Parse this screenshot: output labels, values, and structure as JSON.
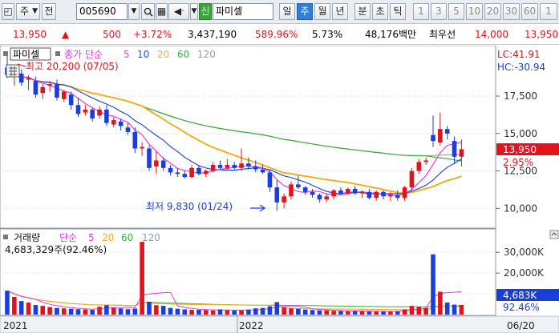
{
  "toolbar": {
    "period_type": "주",
    "prev_label": "전",
    "code": "005690",
    "sin_label": "신",
    "name": "파미셀",
    "periods": [
      "일",
      "주",
      "월",
      "년",
      "분",
      "초",
      "틱"
    ],
    "selected_period": "주",
    "numbers": [
      "1",
      "3",
      "5",
      "10",
      "20",
      "30",
      "60",
      "1"
    ]
  },
  "quote": {
    "price": "13,950",
    "change": "500",
    "change_pct": "+3.72%",
    "volume": "3,437,190",
    "vol_ratio": "589.96%",
    "turnover": "5.73%",
    "amount": "48,176백만",
    "best_ask_label": "최우선",
    "best_ask": "14,000",
    "best_bid": "13,950"
  },
  "colors": {
    "up": "#e0141e",
    "down": "#1a3fd8",
    "ma5": "#e83ae0",
    "ma10": "#2a4fd8",
    "ma20": "#f0b020",
    "ma60": "#3cae3c",
    "ma120": "#a0a0a0"
  },
  "price_panel": {
    "title": "파미셀",
    "legend_prefix": "종가 단순",
    "legend_items": [
      "5",
      "10",
      "20",
      "60",
      "120"
    ],
    "lc": "LC:41.91",
    "hc": "HC:-30.94",
    "high_label": "최고 20,200 (07/05)",
    "low_label": "최저 9,830 (01/24)",
    "axis": [
      "17,500",
      "15,000",
      "12,500",
      "10,000"
    ],
    "current_tag": "13,950",
    "pct_tag": "2.95%"
  },
  "volume_panel": {
    "title": "거래량",
    "legend_prefix": "단순",
    "legend_items": [
      "5",
      "20",
      "60",
      "120"
    ],
    "value_label": "4,683,329주(92.46%)",
    "axis": [
      "30,000K",
      "20,000K",
      "10,000K"
    ],
    "current_tag": "4,683K",
    "pct_tag": "92.46%"
  },
  "x_axis": {
    "labels": [
      "2021",
      "2022"
    ],
    "right_label": "06/20"
  },
  "chart_data": {
    "type": "candlestick",
    "price_ylim": [
      9000,
      19800
    ],
    "volume_ylim": [
      0,
      37000000
    ],
    "candles": [
      {
        "o": 19400,
        "h": 20200,
        "l": 18700,
        "c": 18900
      },
      {
        "o": 18800,
        "h": 19300,
        "l": 18200,
        "c": 19000
      },
      {
        "o": 19000,
        "h": 19300,
        "l": 18200,
        "c": 18400
      },
      {
        "o": 18600,
        "h": 18900,
        "l": 17900,
        "c": 18700
      },
      {
        "o": 18500,
        "h": 18800,
        "l": 17400,
        "c": 17600
      },
      {
        "o": 17700,
        "h": 18300,
        "l": 17300,
        "c": 18100
      },
      {
        "o": 18200,
        "h": 18500,
        "l": 17800,
        "c": 18300
      },
      {
        "o": 18300,
        "h": 18600,
        "l": 17200,
        "c": 17400
      },
      {
        "o": 17300,
        "h": 17900,
        "l": 17100,
        "c": 17800
      },
      {
        "o": 17600,
        "h": 17800,
        "l": 16600,
        "c": 16900
      },
      {
        "o": 16900,
        "h": 17400,
        "l": 16100,
        "c": 16300
      },
      {
        "o": 16400,
        "h": 16900,
        "l": 16200,
        "c": 16600
      },
      {
        "o": 16600,
        "h": 16700,
        "l": 15800,
        "c": 16000
      },
      {
        "o": 16200,
        "h": 16800,
        "l": 16000,
        "c": 16600
      },
      {
        "o": 16600,
        "h": 16900,
        "l": 15500,
        "c": 15700
      },
      {
        "o": 15600,
        "h": 16100,
        "l": 15400,
        "c": 15900
      },
      {
        "o": 15800,
        "h": 16000,
        "l": 15200,
        "c": 15500
      },
      {
        "o": 15400,
        "h": 15700,
        "l": 14900,
        "c": 15100
      },
      {
        "o": 15100,
        "h": 15400,
        "l": 13700,
        "c": 14000
      },
      {
        "o": 14000,
        "h": 14400,
        "l": 13500,
        "c": 14100
      },
      {
        "o": 14000,
        "h": 14200,
        "l": 12500,
        "c": 12700
      },
      {
        "o": 12800,
        "h": 13800,
        "l": 12300,
        "c": 13200
      },
      {
        "o": 13200,
        "h": 13400,
        "l": 12500,
        "c": 12700
      },
      {
        "o": 12700,
        "h": 12900,
        "l": 12200,
        "c": 12400
      },
      {
        "o": 12400,
        "h": 12700,
        "l": 12100,
        "c": 12300
      },
      {
        "o": 12300,
        "h": 12500,
        "l": 12000,
        "c": 12100
      },
      {
        "o": 12100,
        "h": 12900,
        "l": 12000,
        "c": 12700
      },
      {
        "o": 12700,
        "h": 12900,
        "l": 12200,
        "c": 12300
      },
      {
        "o": 12300,
        "h": 12600,
        "l": 12100,
        "c": 12500
      },
      {
        "o": 12500,
        "h": 13100,
        "l": 12400,
        "c": 12900
      },
      {
        "o": 12900,
        "h": 13200,
        "l": 12600,
        "c": 12700
      },
      {
        "o": 12700,
        "h": 13300,
        "l": 12600,
        "c": 12900
      },
      {
        "o": 12900,
        "h": 13100,
        "l": 12600,
        "c": 12700
      },
      {
        "o": 12700,
        "h": 14000,
        "l": 12500,
        "c": 13000
      },
      {
        "o": 13000,
        "h": 13400,
        "l": 12600,
        "c": 12800
      },
      {
        "o": 12800,
        "h": 13200,
        "l": 12400,
        "c": 12600
      },
      {
        "o": 12600,
        "h": 12900,
        "l": 12300,
        "c": 12400
      },
      {
        "o": 12400,
        "h": 12600,
        "l": 11100,
        "c": 11400
      },
      {
        "o": 11400,
        "h": 11900,
        "l": 9830,
        "c": 10400
      },
      {
        "o": 10400,
        "h": 11000,
        "l": 10000,
        "c": 10800
      },
      {
        "o": 10800,
        "h": 11800,
        "l": 10600,
        "c": 11600
      },
      {
        "o": 11600,
        "h": 12200,
        "l": 11300,
        "c": 11400
      },
      {
        "o": 11400,
        "h": 11500,
        "l": 10900,
        "c": 11100
      },
      {
        "o": 11100,
        "h": 11300,
        "l": 10700,
        "c": 10900
      },
      {
        "o": 10900,
        "h": 11000,
        "l": 10400,
        "c": 10600
      },
      {
        "o": 10600,
        "h": 11000,
        "l": 10400,
        "c": 10800
      },
      {
        "o": 10800,
        "h": 11300,
        "l": 10600,
        "c": 11200
      },
      {
        "o": 11200,
        "h": 11400,
        "l": 10900,
        "c": 11000
      },
      {
        "o": 11000,
        "h": 11400,
        "l": 10900,
        "c": 11300
      },
      {
        "o": 11300,
        "h": 11500,
        "l": 10900,
        "c": 11000
      },
      {
        "o": 11000,
        "h": 11200,
        "l": 10700,
        "c": 11100
      },
      {
        "o": 11100,
        "h": 11300,
        "l": 10600,
        "c": 10700
      },
      {
        "o": 10700,
        "h": 11200,
        "l": 10500,
        "c": 11100
      },
      {
        "o": 11100,
        "h": 11200,
        "l": 10600,
        "c": 10800
      },
      {
        "o": 10800,
        "h": 11100,
        "l": 10500,
        "c": 10900
      },
      {
        "o": 10900,
        "h": 11200,
        "l": 10500,
        "c": 10700
      },
      {
        "o": 10700,
        "h": 11500,
        "l": 10500,
        "c": 11400
      },
      {
        "o": 11400,
        "h": 12700,
        "l": 11200,
        "c": 12500
      },
      {
        "o": 12500,
        "h": 13300,
        "l": 12300,
        "c": 13100
      },
      {
        "o": 13100,
        "h": 13400,
        "l": 12900,
        "c": 13200
      },
      {
        "o": 14900,
        "h": 16200,
        "l": 14100,
        "c": 14500
      },
      {
        "o": 14400,
        "h": 16400,
        "l": 14200,
        "c": 15300
      },
      {
        "o": 15300,
        "h": 15500,
        "l": 14600,
        "c": 15000
      },
      {
        "o": 14500,
        "h": 14800,
        "l": 13000,
        "c": 13450
      },
      {
        "o": 13450,
        "h": 14600,
        "l": 12800,
        "c": 13950
      }
    ],
    "volumes": [
      11500000,
      8500000,
      6500000,
      5800000,
      4600000,
      4200000,
      3600000,
      3200000,
      3000000,
      2800000,
      2600000,
      2500000,
      2300000,
      3800000,
      4500000,
      3400000,
      3000000,
      2600000,
      2900000,
      35000000,
      6200000,
      4500000,
      4200000,
      3200000,
      2800000,
      2500000,
      2300000,
      2300000,
      2200000,
      2000000,
      2500000,
      2100000,
      2000000,
      2000000,
      2400000,
      3000000,
      3200000,
      4000000,
      6000000,
      3500000,
      3000000,
      2800000,
      2400000,
      2200000,
      2000000,
      2000000,
      1800000,
      1700000,
      1600000,
      1700000,
      1600000,
      1500000,
      1500000,
      1500000,
      1500000,
      1600000,
      2500000,
      4200000,
      3800000,
      3200000,
      29000000,
      11000000,
      5800000,
      4800000,
      4683329
    ]
  }
}
